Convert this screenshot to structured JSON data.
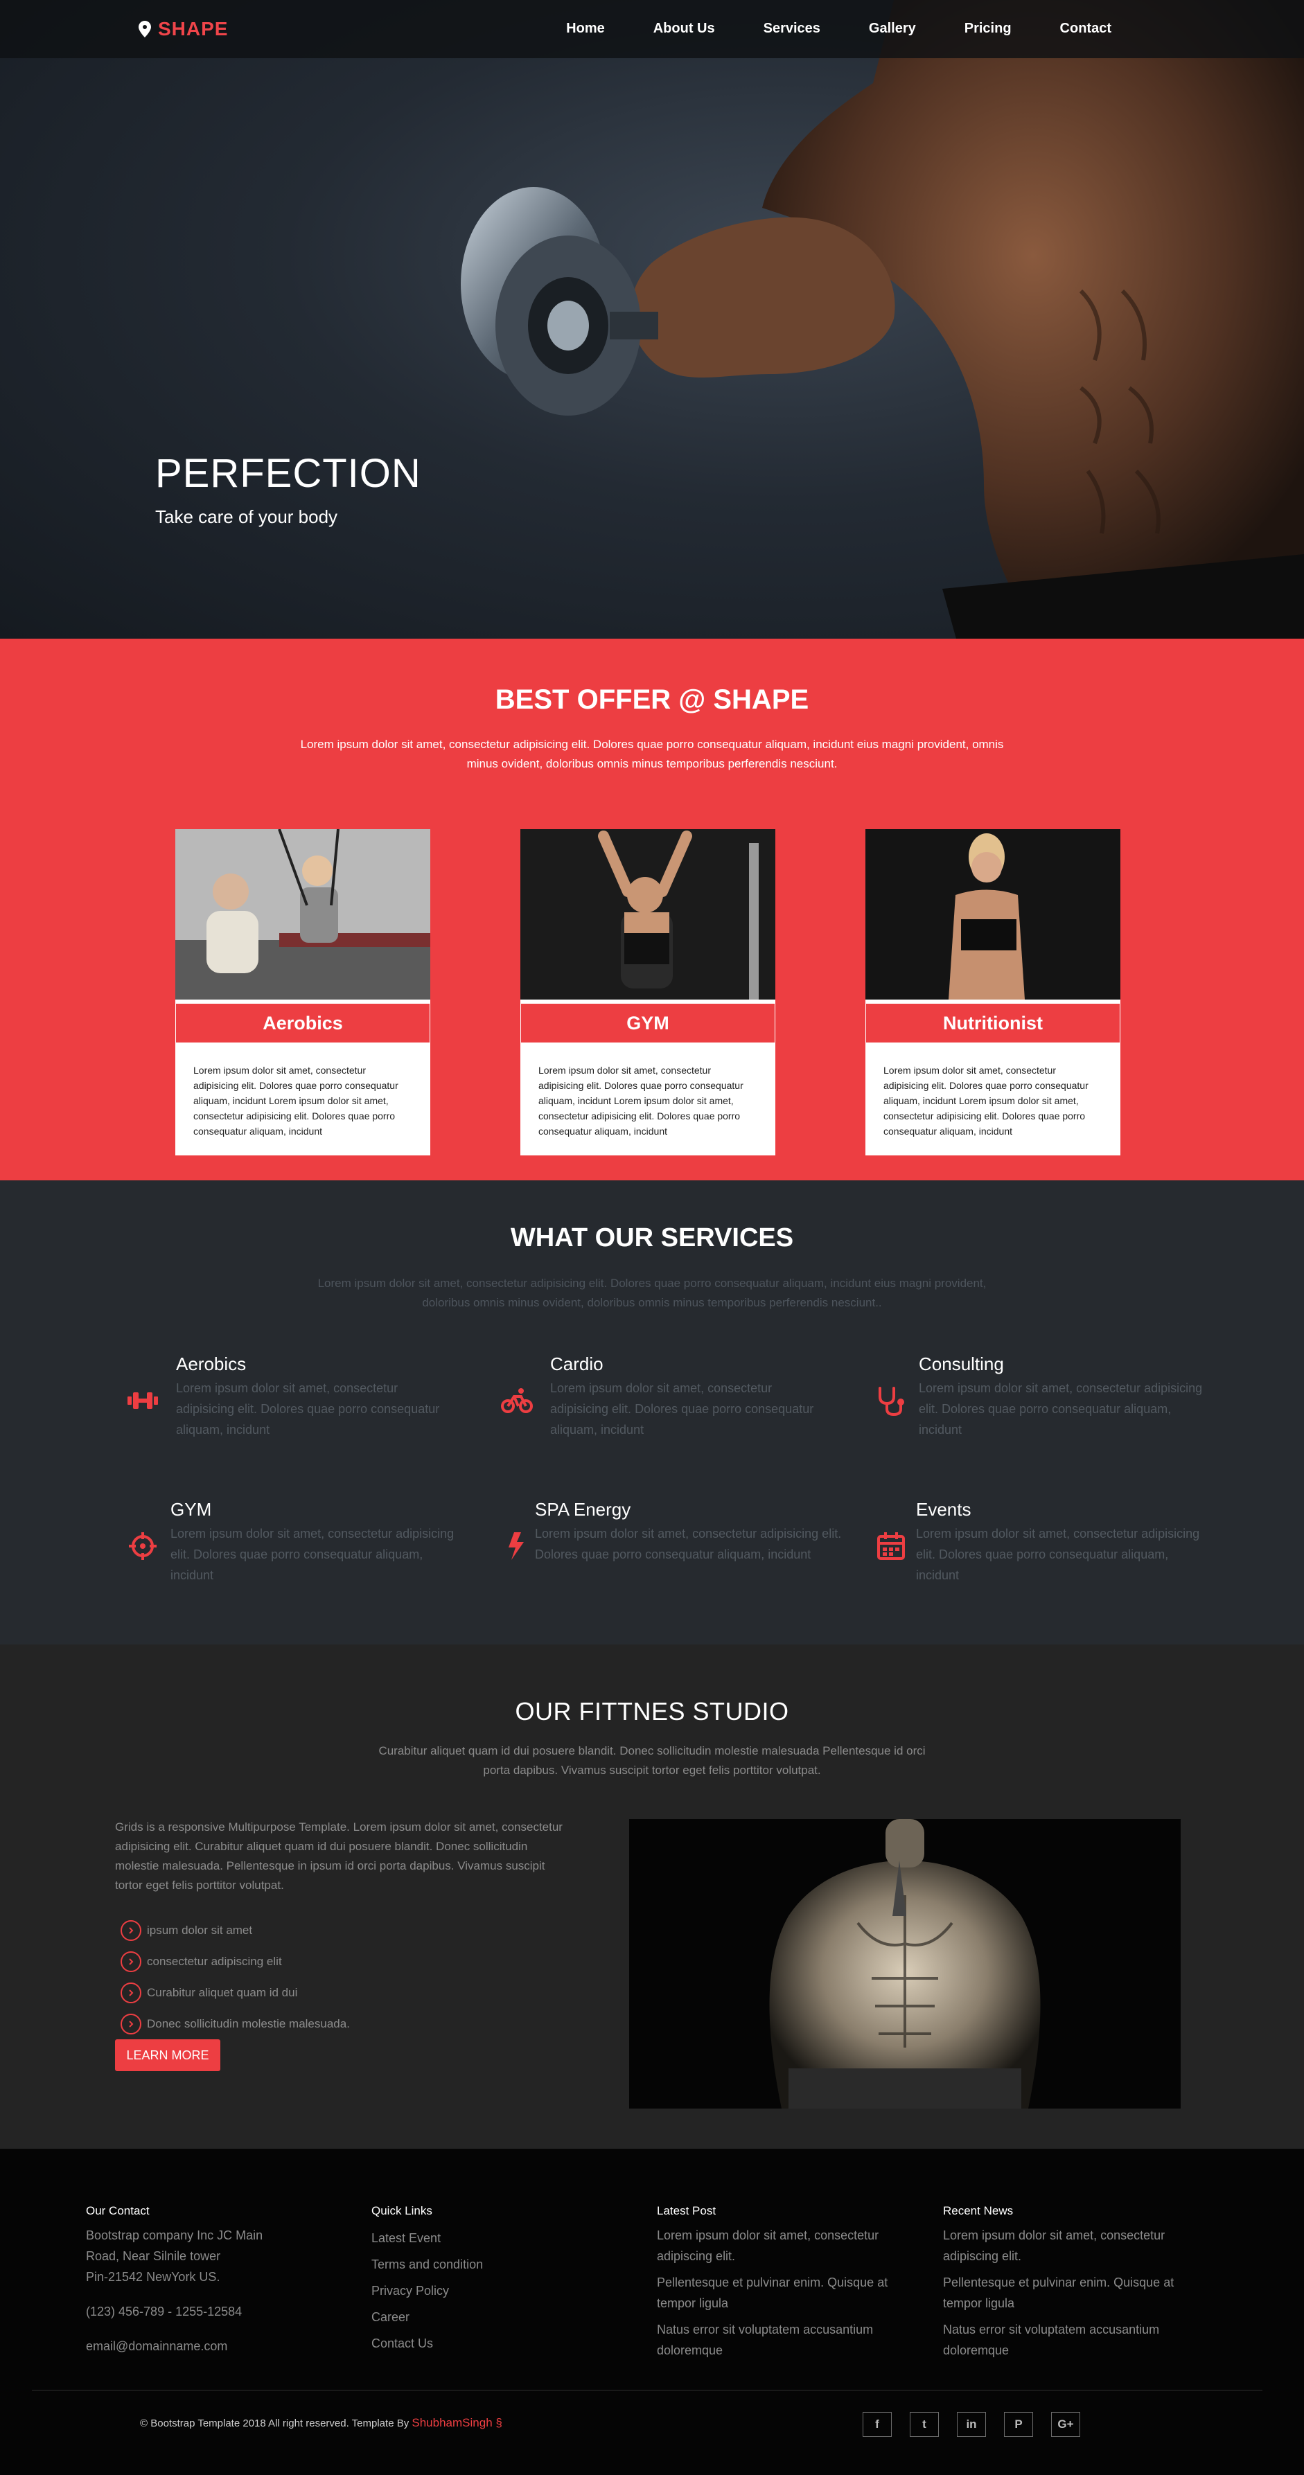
{
  "nav": {
    "brand": "SHAPE",
    "items": [
      "Home",
      "About Us",
      "Services",
      "Gallery",
      "Pricing",
      "Contact"
    ]
  },
  "hero": {
    "title": "PERFECTION",
    "subtitle": "Take care of your body"
  },
  "offer": {
    "title": "BEST OFFER @ SHAPE",
    "lead": "Lorem ipsum dolor sit amet, consectetur adipisicing elit. Dolores quae porro consequatur aliquam, incidunt eius magni provident, omnis minus ovident, doloribus omnis minus temporibus perferendis nesciunt.",
    "cards": [
      {
        "title": "Aerobics",
        "text": "Lorem ipsum dolor sit amet, consectetur adipisicing elit. Dolores quae porro consequatur aliquam, incidunt Lorem ipsum dolor sit amet, consectetur adipisicing elit. Dolores quae porro consequatur aliquam, incidunt"
      },
      {
        "title": "GYM",
        "text": "Lorem ipsum dolor sit amet, consectetur adipisicing elit. Dolores quae porro consequatur aliquam, incidunt Lorem ipsum dolor sit amet, consectetur adipisicing elit. Dolores quae porro consequatur aliquam, incidunt"
      },
      {
        "title": "Nutritionist",
        "text": "Lorem ipsum dolor sit amet, consectetur adipisicing elit. Dolores quae porro consequatur aliquam, incidunt Lorem ipsum dolor sit amet, consectetur adipisicing elit. Dolores quae porro consequatur aliquam, incidunt"
      }
    ]
  },
  "services": {
    "title": "WHAT OUR SERVICES",
    "lead": "Lorem ipsum dolor sit amet, consectetur adipisicing elit. Dolores quae porro consequatur aliquam, incidunt eius magni provident, doloribus omnis minus ovident, doloribus omnis minus temporibus perferendis nesciunt..",
    "items": [
      {
        "title": "Aerobics",
        "text": "Lorem ipsum dolor sit amet, consectetur adipisicing elit. Dolores quae porro consequatur aliquam, incidunt",
        "icon": "dumbbell-icon"
      },
      {
        "title": "Cardio",
        "text": "Lorem ipsum dolor sit amet, consectetur adipisicing elit. Dolores quae porro consequatur aliquam, incidunt",
        "icon": "bicycle-icon"
      },
      {
        "title": "Consulting",
        "text": "Lorem ipsum dolor sit amet, consectetur adipisicing elit. Dolores quae porro consequatur aliquam, incidunt",
        "icon": "stethoscope-icon"
      },
      {
        "title": "GYM",
        "text": "Lorem ipsum dolor sit amet, consectetur adipisicing elit. Dolores quae porro consequatur aliquam, incidunt",
        "icon": "crosshair-icon"
      },
      {
        "title": "SPA Energy",
        "text": "Lorem ipsum dolor sit amet, consectetur adipisicing elit. Dolores quae porro consequatur aliquam, incidunt",
        "icon": "bolt-icon"
      },
      {
        "title": "Events",
        "text": "Lorem ipsum dolor sit amet, consectetur adipisicing elit. Dolores quae porro consequatur aliquam, incidunt",
        "icon": "calendar-icon"
      }
    ]
  },
  "studio": {
    "title": "OUR FITTNES STUDIO",
    "lead": "Curabitur aliquet quam id dui posuere blandit. Donec sollicitudin molestie malesuada Pellentesque id orci porta dapibus. Vivamus suscipit tortor eget felis porttitor volutpat.",
    "body": "Grids is a responsive Multipurpose Template. Lorem ipsum dolor sit amet, consectetur adipisicing elit. Curabitur aliquet quam id dui posuere blandit. Donec sollicitudin molestie malesuada. Pellentesque in ipsum id orci porta dapibus. Vivamus suscipit tortor eget felis porttitor volutpat.",
    "list": [
      "ipsum dolor sit amet",
      "consectetur adipiscing elit",
      "Curabitur aliquet quam id dui",
      "Donec sollicitudin molestie malesuada."
    ],
    "button": "LEARN MORE"
  },
  "footer": {
    "contact": {
      "heading": "Our Contact",
      "address": [
        "Bootstrap company Inc JC Main",
        "Road, Near Silnile tower",
        "Pin-21542 NewYork US."
      ],
      "phone": "(123) 456-789 - 1255-12584",
      "email": "email@domainname.com"
    },
    "links": {
      "heading": "Quick Links",
      "items": [
        "Latest Event",
        "Terms and condition",
        "Privacy Policy",
        "Career",
        "Contact Us"
      ]
    },
    "latest": {
      "heading": "Latest Post",
      "items": [
        "Lorem ipsum dolor sit amet, consectetur adipiscing elit.",
        "Pellentesque et pulvinar enim. Quisque at tempor ligula",
        "Natus error sit voluptatem accusantium doloremque"
      ]
    },
    "news": {
      "heading": "Recent News",
      "items": [
        "Lorem ipsum dolor sit amet, consectetur adipiscing elit.",
        "Pellentesque et pulvinar enim. Quisque at tempor ligula",
        "Natus error sit voluptatem accusantium doloremque"
      ]
    },
    "copyright": "© Bootstrap Template 2018 All right reserved. Template By",
    "author": "ShubhamSingh §",
    "social": [
      "facebook-icon",
      "twitter-icon",
      "linkedin-icon",
      "pinterest-icon",
      "google-plus-icon"
    ],
    "social_glyphs": [
      "f",
      "t",
      "in",
      "P",
      "G+"
    ]
  },
  "colors": {
    "accent": "#ed3e42",
    "dark": "#262a2f",
    "studio": "#242424",
    "footer": "#050505"
  }
}
